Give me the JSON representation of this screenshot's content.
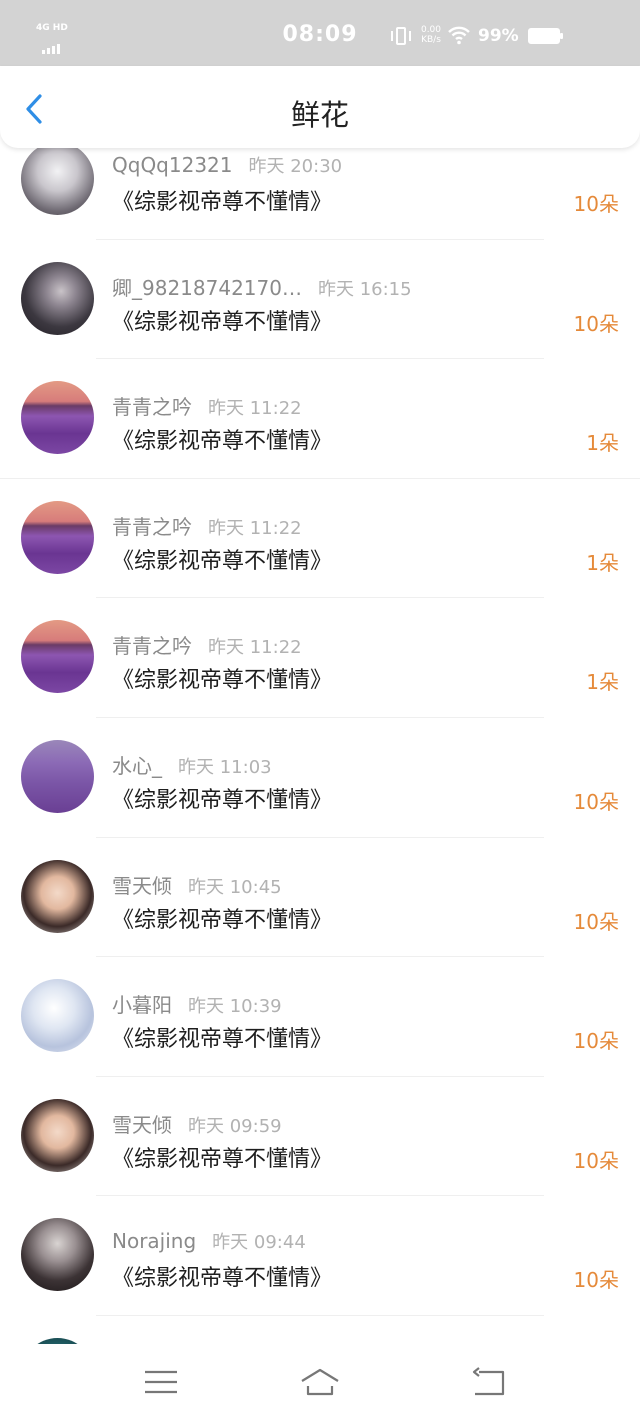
{
  "status_bar": {
    "network_label": "4G HD",
    "time": "08:09",
    "speed_value": "0.00",
    "speed_unit": "KB/s",
    "battery": "99%"
  },
  "header": {
    "title": "鲜花",
    "back_icon": "chevron-left-icon",
    "accent_color": "#2f8ee6"
  },
  "rows": [
    {
      "avatar": "umbrella-portrait",
      "name": "QqQq12321",
      "time": "昨天 20:30",
      "book": "《综影视帝尊不懂情》",
      "amount": "10朵"
    },
    {
      "avatar": "cosplay-portrait",
      "name": "卿_98218742170…",
      "time": "昨天 16:15",
      "book": "《综影视帝尊不懂情》",
      "amount": "10朵"
    },
    {
      "avatar": "lavender-field",
      "name": "青青之吟",
      "time": "昨天 11:22",
      "book": "《综影视帝尊不懂情》",
      "amount": "1朵"
    },
    {
      "avatar": "lavender-field",
      "name": "青青之吟",
      "time": "昨天 11:22",
      "book": "《综影视帝尊不懂情》",
      "amount": "1朵"
    },
    {
      "avatar": "lavender-field",
      "name": "青青之吟",
      "time": "昨天 11:22",
      "book": "《综影视帝尊不懂情》",
      "amount": "1朵"
    },
    {
      "avatar": "lavender-field-2",
      "name": "水心_",
      "time": "昨天 11:03",
      "book": "《综影视帝尊不懂情》",
      "amount": "10朵"
    },
    {
      "avatar": "woman-portrait",
      "name": "雪天倾",
      "time": "昨天 10:45",
      "book": "《综影视帝尊不懂情》",
      "amount": "10朵"
    },
    {
      "avatar": "anime-portrait",
      "name": "小暮阳",
      "time": "昨天 10:39",
      "book": "《综影视帝尊不懂情》",
      "amount": "10朵"
    },
    {
      "avatar": "woman-portrait",
      "name": "雪天倾",
      "time": "昨天 09:59",
      "book": "《综影视帝尊不懂情》",
      "amount": "10朵"
    },
    {
      "avatar": "noir-portrait",
      "name": "Norajing",
      "time": "昨天 09:44",
      "book": "《综影视帝尊不懂情》",
      "amount": "10朵"
    },
    {
      "avatar": "teal-portrait",
      "name": "",
      "time": "",
      "book": "",
      "amount": ""
    }
  ],
  "navbar": {
    "menu_icon": "menu-icon",
    "home_icon": "home-icon",
    "back_icon": "back-arrow-icon"
  },
  "colors": {
    "status_bar_bg": "#d3d3d3",
    "amount": "#e58a3a",
    "name": "#8a8a8a",
    "time": "#b2b2b2"
  }
}
